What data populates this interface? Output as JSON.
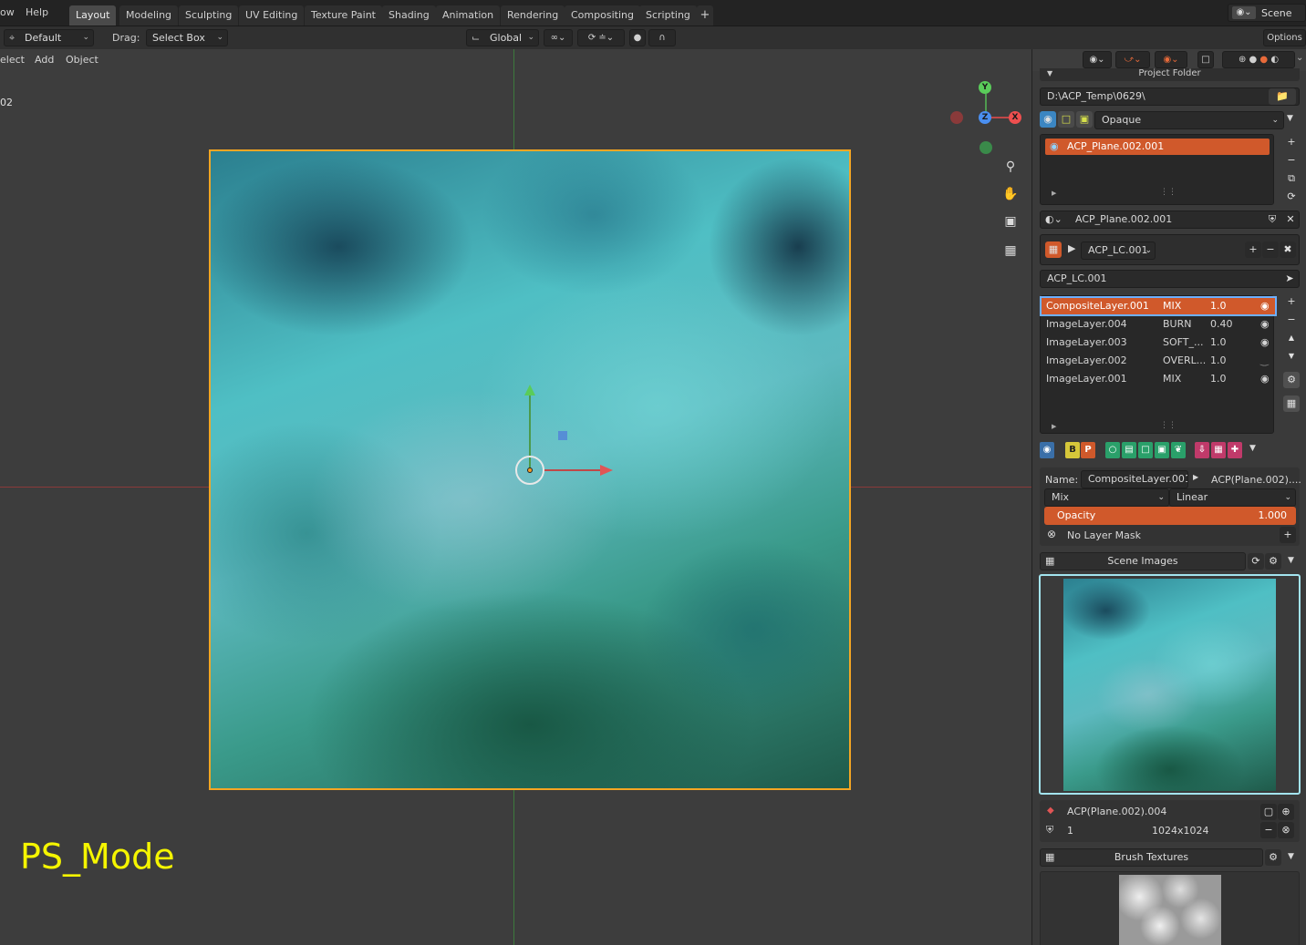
{
  "top_menu": {
    "items": [
      "ow",
      "Help"
    ]
  },
  "workspace_tabs": [
    "Layout",
    "Modeling",
    "Sculpting",
    "UV Editing",
    "Texture Paint",
    "Shading",
    "Animation",
    "Rendering",
    "Compositing",
    "Scripting"
  ],
  "workspace_active": "Layout",
  "add_workspace": "+",
  "scene": {
    "label": "Scene"
  },
  "toolbar": {
    "mode": "Default",
    "drag_label": "Drag:",
    "drag_value": "Select Box",
    "orientation": "Global",
    "options": "Options"
  },
  "viewport": {
    "menu": [
      "elect",
      "Add",
      "Object"
    ],
    "object_label": "02",
    "overlay_text": "PS_Mode",
    "nav_gizmo": {
      "y": "Y",
      "z": "Z",
      "x": "X"
    }
  },
  "right_panel": {
    "project_folder_label": "Project Folder",
    "project_folder_path": "D:\\ACP_Temp\\0629\\",
    "blend_mode": "Opaque",
    "object_list": [
      "ACP_Plane.002.001"
    ],
    "material_name": "ACP_Plane.002.001",
    "layer_collection": "ACP_LC.001",
    "layer_collection_field": "ACP_LC.001",
    "layers": [
      {
        "name": "CompositeLayer.001",
        "blend": "MIX",
        "opacity": "1.0",
        "visible": true,
        "active": true
      },
      {
        "name": "ImageLayer.004",
        "blend": "BURN",
        "opacity": "0.40",
        "visible": true,
        "active": false
      },
      {
        "name": "ImageLayer.003",
        "blend": "SOFT_...",
        "opacity": "1.0",
        "visible": true,
        "active": false
      },
      {
        "name": "ImageLayer.002",
        "blend": "OVERL...",
        "opacity": "1.0",
        "visible": false,
        "active": false
      },
      {
        "name": "ImageLayer.001",
        "blend": "MIX",
        "opacity": "1.0",
        "visible": true,
        "active": false
      }
    ],
    "props": {
      "name_label": "Name:",
      "name_value": "CompositeLayer.001",
      "source_value": "ACP(Plane.002)....",
      "blend": "Mix",
      "interp": "Linear",
      "opacity_label": "Opacity",
      "opacity_value": "1.000",
      "mask_label": "No Layer Mask"
    },
    "scene_images_label": "Scene Images",
    "image_info": {
      "name": "ACP(Plane.002).004",
      "users": "1",
      "size": "1024x1024"
    },
    "brush_textures_label": "Brush Textures"
  },
  "colors": {
    "accent_orange": "#d0592b",
    "selection_outline": "#f5a623",
    "ps_mode_text": "#f5f500"
  }
}
